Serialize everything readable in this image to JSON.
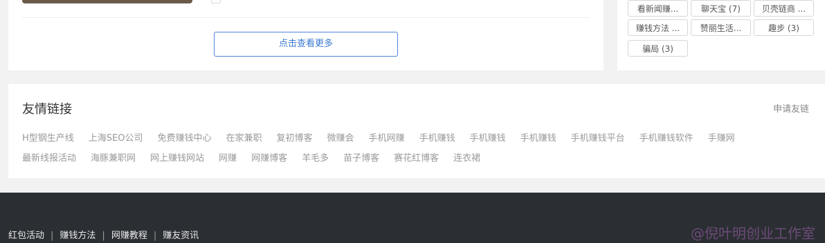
{
  "main": {
    "more_button": "点击查看更多"
  },
  "sidebar": {
    "tags": [
      "看新闻赚...",
      "聊天宝 (7)",
      "贝壳链商 ...",
      "赚钱方法 ...",
      "赞丽生活...",
      "趣步 (3)",
      "骗局 (3)"
    ]
  },
  "friend_links": {
    "title": "友情链接",
    "apply": "申请友链",
    "row1": [
      "H型钢生产线",
      "上海SEO公司",
      "免费赚钱中心",
      "在家兼职",
      "复初博客",
      "微赚会",
      "手机网赚",
      "手机赚钱",
      "手机赚钱",
      "手机赚钱",
      "手机赚钱平台",
      "手机赚钱软件",
      "手赚网"
    ],
    "row2": [
      "最新线报活动",
      "海豚兼职网",
      "网上赚钱网站",
      "网赚",
      "网赚博客",
      "羊毛多",
      "苗子博客",
      "赛花红博客",
      "连衣裙"
    ]
  },
  "footer": {
    "nav": [
      "红包活动",
      "赚钱方法",
      "网赚教程",
      "赚友资讯"
    ],
    "separator": "|",
    "watermark": "@倪叶明创业工作室"
  }
}
